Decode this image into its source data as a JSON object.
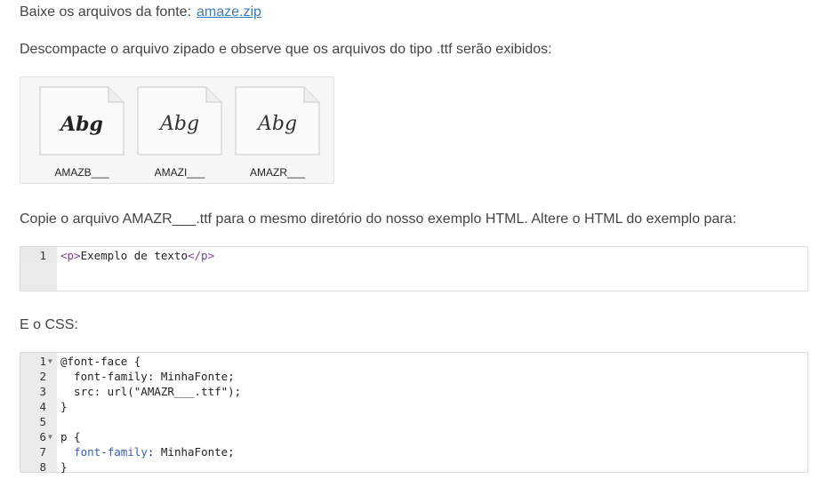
{
  "download": {
    "label": "Baixe os arquivos da fonte:",
    "link": "amaze.zip"
  },
  "intro_text": "Descompacte o arquivo zipado e observe que os arquivos do tipo .ttf serão exibidos:",
  "font_files": [
    {
      "glyph": "Abg",
      "name": "AMAZB___"
    },
    {
      "glyph": "Abg",
      "name": "AMAZI___"
    },
    {
      "glyph": "Abg",
      "name": "AMAZR___"
    }
  ],
  "copy_text": "Copie o arquivo AMAZR___.ttf para o mesmo diretório do nosso exemplo HTML. Altere o HTML do exemplo para:",
  "html_code": {
    "line_number": "1",
    "open_tag": "<p>",
    "text": "Exemplo de texto",
    "close_tag": "</p>"
  },
  "css_label": "E o CSS:",
  "css_code": {
    "line_numbers": [
      "1",
      "2",
      "3",
      "4",
      "5",
      "6",
      "7",
      "8"
    ],
    "lines": [
      "@font-face {",
      "  font-family: MinhaFonte;",
      "  src: url(\"AMAZR___.ttf\");",
      "}",
      "",
      "p {",
      "  ",
      "}"
    ],
    "line7_prop": "font-family",
    "line7_value": ": MinhaFonte;"
  },
  "colors": {
    "link": "#3a7ab8",
    "gutter": "#ebebeb",
    "tag": "#7a3e9d",
    "property": "#3c5dab"
  }
}
